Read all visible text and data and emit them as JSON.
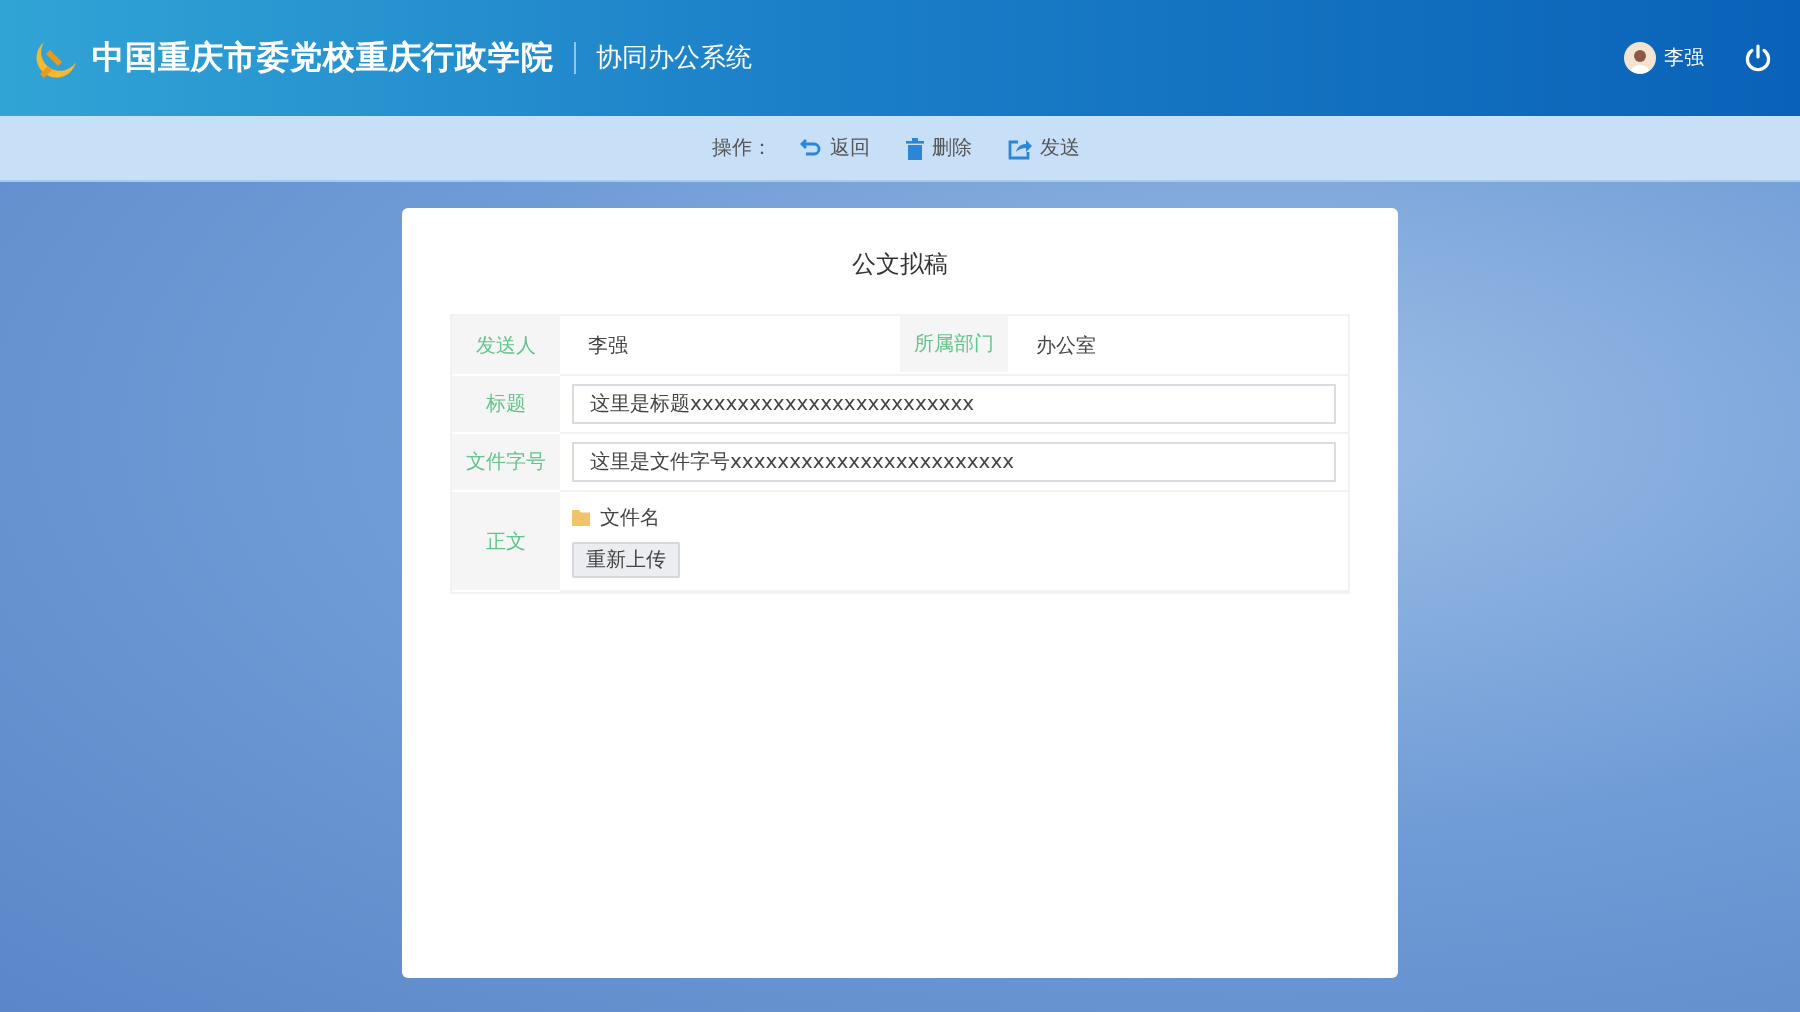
{
  "header": {
    "title": "中国重庆市委党校重庆行政学院",
    "subtitle": "协同办公系统",
    "user": "李强"
  },
  "toolbar": {
    "label": "操作：",
    "actions": [
      {
        "kind": "back",
        "label": "返回"
      },
      {
        "kind": "delete",
        "label": "删除"
      },
      {
        "kind": "send",
        "label": "发送"
      }
    ]
  },
  "form": {
    "title": "公文拟稿",
    "sender": {
      "label": "发送人",
      "value": "李强"
    },
    "department": {
      "label": "所属部门",
      "value": "办公室"
    },
    "fields": [
      {
        "label": "标题",
        "value": "这里是标题xxxxxxxxxxxxxxxxxxxxxxxx"
      },
      {
        "label": "文件字号",
        "value": "这里是文件字号xxxxxxxxxxxxxxxxxxxxxxxx"
      }
    ],
    "body": {
      "label": "正文",
      "file": "文件名",
      "button": "重新上传"
    }
  }
}
